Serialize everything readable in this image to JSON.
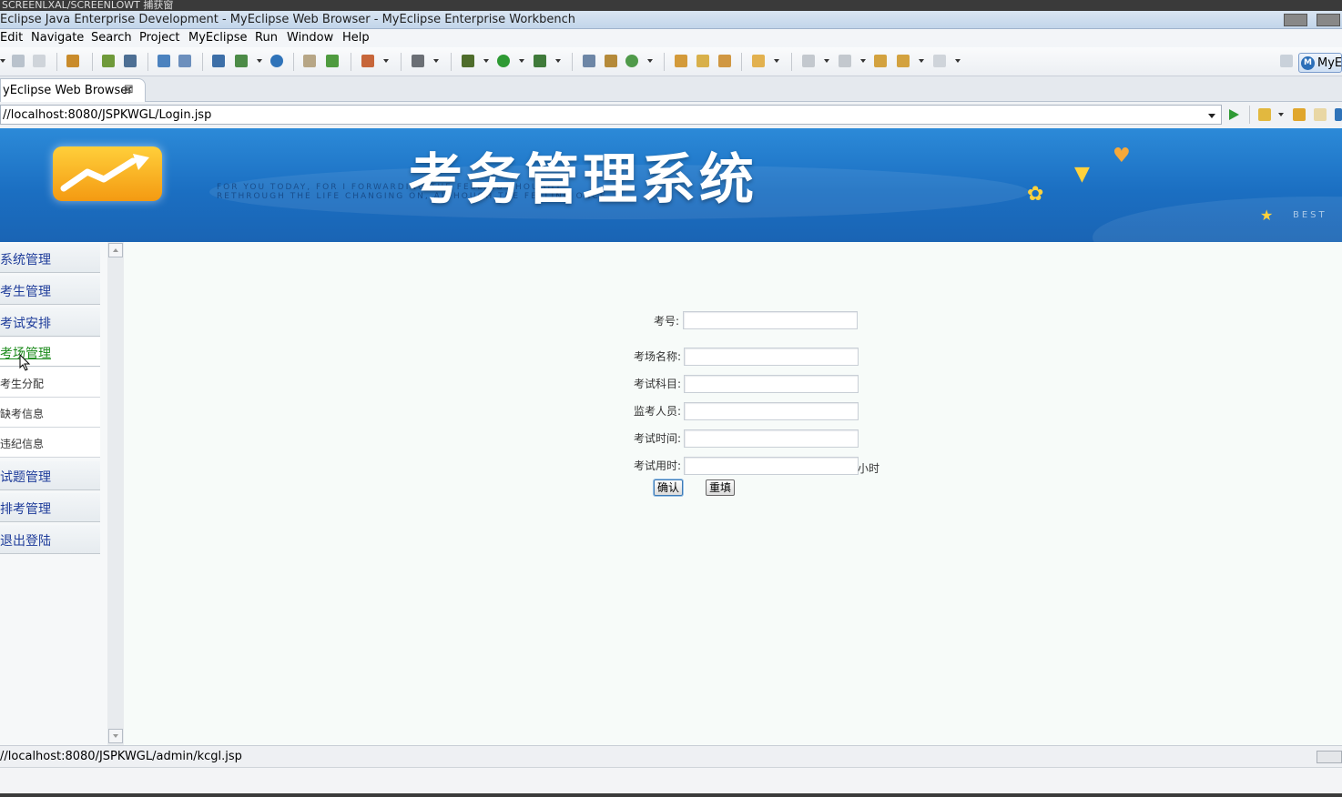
{
  "window": {
    "top_strip_text": "SCREENLXAL/SCREENLOWT 捕获窗",
    "title": "Eclipse Java Enterprise Development - MyEclipse Web Browser - MyEclipse Enterprise Workbench"
  },
  "menu": [
    "Edit",
    "Navigate",
    "Search",
    "Project",
    "MyEclipse",
    "Run",
    "Window",
    "Help"
  ],
  "perspective_button": "MyE",
  "tab": {
    "label": "yEclipse Web Browser",
    "close": "⊠"
  },
  "url": "//localhost:8080/JSPKWGL/Login.jsp",
  "banner": {
    "title": "考务管理系统",
    "deco_line1": "FOR YOU TODAY, FOR I FORWARDING THE FEELING THOUGHT",
    "deco_line2": "RETHROUGH THE LIFE CHANGING ON, ALTHOUGH THE FEELING ONCE",
    "best": "BEST"
  },
  "sidebar": [
    {
      "label": "系统管理",
      "type": "group"
    },
    {
      "label": "考生管理",
      "type": "group"
    },
    {
      "label": "考试安排",
      "type": "group"
    },
    {
      "label": "考场管理",
      "type": "group",
      "active": true
    },
    {
      "label": "考生分配",
      "type": "sub"
    },
    {
      "label": "缺考信息",
      "type": "sub"
    },
    {
      "label": "违纪信息",
      "type": "sub"
    },
    {
      "label": "试题管理",
      "type": "group"
    },
    {
      "label": "排考管理",
      "type": "group"
    },
    {
      "label": "退出登陆",
      "type": "group"
    }
  ],
  "form": {
    "fields": [
      {
        "label": "考号:",
        "value": ""
      },
      {
        "label": "考场名称:",
        "value": ""
      },
      {
        "label": "考试科目:",
        "value": ""
      },
      {
        "label": "监考人员:",
        "value": ""
      },
      {
        "label": "考试时间:",
        "value": ""
      },
      {
        "label": "考试用时:",
        "value": ""
      }
    ],
    "duration_unit": "小时",
    "confirm_label": "确认",
    "reset_label": "重填"
  },
  "status_url": "//localhost:8080/JSPKWGL/admin/kcgl.jsp",
  "colors": {
    "banner": "#1b6fc2",
    "nav_text": "#1e3c9a",
    "nav_active": "#1a8a1a",
    "content_bg": "#f7fbf9"
  }
}
